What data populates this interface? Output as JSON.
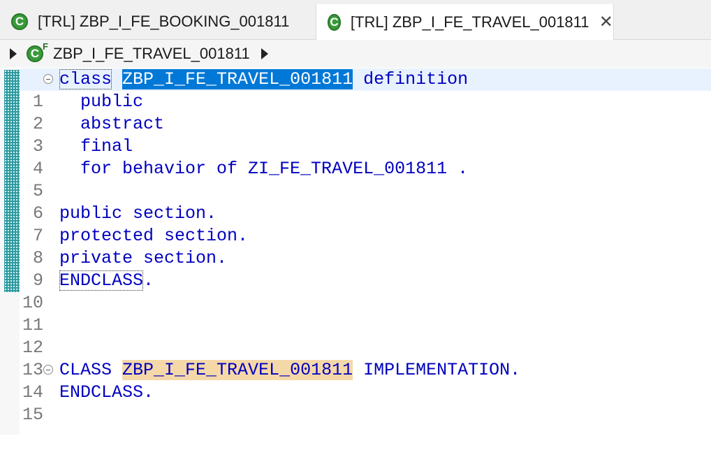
{
  "tabs": [
    {
      "label": "[TRL] ZBP_I_FE_BOOKING_001811",
      "icon": "class-icon",
      "active": false
    },
    {
      "label": "[TRL] ZBP_I_FE_TRAVEL_001811",
      "icon": "class-icon",
      "active": true
    }
  ],
  "breadcrumb": {
    "label": "ZBP_I_FE_TRAVEL_001811",
    "icon": "class-icon"
  },
  "editor": {
    "line_numbers": [
      "1",
      "2",
      "3",
      "4",
      "5",
      "6",
      "7",
      "8",
      "9",
      "10",
      "11",
      "12",
      "13",
      "14",
      "15"
    ],
    "lines": {
      "l1": {
        "kw": "class",
        "name": "ZBP_I_FE_TRAVEL_001811",
        "rest": " definition"
      },
      "l2": "  public",
      "l3": "  abstract",
      "l4": "  final",
      "l5": "  for behavior of ZI_FE_TRAVEL_001811 .",
      "l6": "",
      "l7": "public section.",
      "l8": "protected section.",
      "l9": "private section.",
      "l10": {
        "kw": "ENDCLASS",
        "rest": "."
      },
      "l11": "",
      "l12": "",
      "l13": "",
      "l14": {
        "kw": "CLASS",
        "name": "ZBP_I_FE_TRAVEL_001811",
        "rest": " IMPLEMENTATION."
      },
      "l15": "ENDCLASS."
    }
  },
  "colors": {
    "keyword": "#0000c0",
    "selection": "#0078d7",
    "occurrence": "#f5d8a8",
    "current_line": "#e8f2fe",
    "quick_diff": "#2b9aa0"
  }
}
